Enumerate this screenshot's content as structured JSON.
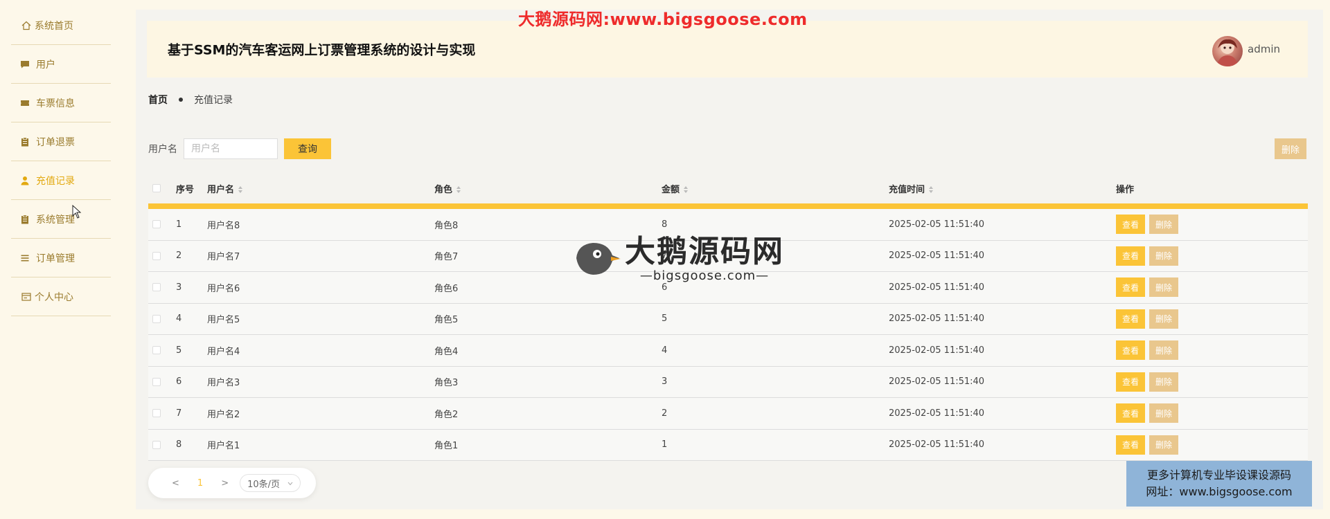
{
  "sidebar": {
    "items": [
      {
        "label": "系统首页",
        "icon": "home-icon"
      },
      {
        "label": "用户",
        "icon": "chat-icon"
      },
      {
        "label": "车票信息",
        "icon": "ticket-icon"
      },
      {
        "label": "订单退票",
        "icon": "clipboard-icon"
      },
      {
        "label": "充值记录",
        "icon": "user-icon",
        "active": true
      },
      {
        "label": "系统管理",
        "icon": "clipboard-icon"
      },
      {
        "label": "订单管理",
        "icon": "list-icon"
      },
      {
        "label": "个人中心",
        "icon": "card-icon"
      }
    ]
  },
  "header": {
    "title": "基于SSM的汽车客运网上订票管理系统的设计与实现",
    "username": "admin"
  },
  "breadcrumb": {
    "home": "首页",
    "current": "充值记录"
  },
  "search": {
    "label": "用户名",
    "placeholder": "用户名",
    "button": "查询"
  },
  "toolbar": {
    "delete_label": "删除"
  },
  "table": {
    "columns": [
      "序号",
      "用户名",
      "角色",
      "金额",
      "充值时间",
      "操作"
    ],
    "rows": [
      {
        "idx": "1",
        "user": "用户名8",
        "role": "角色8",
        "amount": "8",
        "time": "2025-02-05 11:51:40"
      },
      {
        "idx": "2",
        "user": "用户名7",
        "role": "角色7",
        "amount": "7",
        "time": "2025-02-05 11:51:40"
      },
      {
        "idx": "3",
        "user": "用户名6",
        "role": "角色6",
        "amount": "6",
        "time": "2025-02-05 11:51:40"
      },
      {
        "idx": "4",
        "user": "用户名5",
        "role": "角色5",
        "amount": "5",
        "time": "2025-02-05 11:51:40"
      },
      {
        "idx": "5",
        "user": "用户名4",
        "role": "角色4",
        "amount": "4",
        "time": "2025-02-05 11:51:40"
      },
      {
        "idx": "6",
        "user": "用户名3",
        "role": "角色3",
        "amount": "3",
        "time": "2025-02-05 11:51:40"
      },
      {
        "idx": "7",
        "user": "用户名2",
        "role": "角色2",
        "amount": "2",
        "time": "2025-02-05 11:51:40"
      },
      {
        "idx": "8",
        "user": "用户名1",
        "role": "角色1",
        "amount": "1",
        "time": "2025-02-05 11:51:40"
      }
    ],
    "view_label": "查看",
    "delete_label": "删除"
  },
  "pagination": {
    "prev": "<",
    "current": "1",
    "next": ">",
    "page_size": "10条/页"
  },
  "watermark": {
    "top": "大鹅源码网:www.bigsgoose.com",
    "logo_big": "大鹅源码网",
    "logo_small": "—bigsgoose.com—"
  },
  "promo": {
    "line1": "更多计算机专业毕设课设源码",
    "line2": "网址：www.bigsgoose.com"
  },
  "colors": {
    "accent": "#fbc437",
    "danger_light": "#e9c78d",
    "active_text": "#e2a910",
    "watermark_red": "#ee2b2b",
    "promo_bg": "#8fb4d8"
  }
}
